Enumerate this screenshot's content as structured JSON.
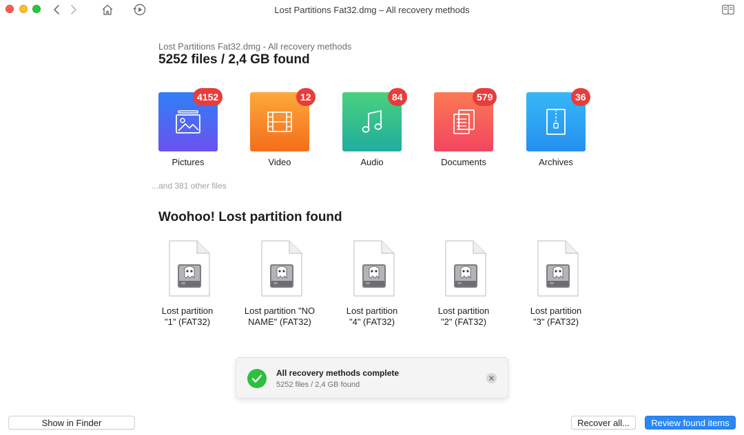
{
  "window": {
    "title": "Lost Partitions Fat32.dmg – All recovery methods"
  },
  "toolbar": {
    "icons": [
      "chevron-left-icon",
      "chevron-right-icon",
      "home-icon",
      "history-icon",
      "sidebar-icon"
    ]
  },
  "header": {
    "subtitle": "Lost Partitions Fat32.dmg - All recovery methods",
    "summary": "5252 files / 2,4 GB found"
  },
  "categories": [
    {
      "label": "Pictures",
      "count": "4152",
      "icon": "picture-icon",
      "colors": [
        "#2f7ff5",
        "#6b52f0"
      ]
    },
    {
      "label": "Video",
      "count": "12",
      "icon": "film-icon",
      "colors": [
        "#fba93a",
        "#f56d1b"
      ]
    },
    {
      "label": "Audio",
      "count": "84",
      "icon": "music-note-icon",
      "colors": [
        "#4ad07f",
        "#1fae9d"
      ]
    },
    {
      "label": "Documents",
      "count": "579",
      "icon": "document-icon",
      "colors": [
        "#fb7a54",
        "#f24561"
      ]
    },
    {
      "label": "Archives",
      "count": "36",
      "icon": "archive-icon",
      "colors": [
        "#36b7f6",
        "#2590f0"
      ]
    }
  ],
  "other_files": "...and 381 other files",
  "partitions": {
    "heading": "Woohoo! Lost partition found",
    "items": [
      {
        "line1": "Lost partition",
        "line2": "\"1\" (FAT32)"
      },
      {
        "line1": "Lost partition \"NO",
        "line2": "NAME\" (FAT32)"
      },
      {
        "line1": "Lost partition",
        "line2": "\"4\" (FAT32)"
      },
      {
        "line1": "Lost partition",
        "line2": "\"2\" (FAT32)"
      },
      {
        "line1": "Lost partition",
        "line2": "\"3\" (FAT32)"
      }
    ]
  },
  "notification": {
    "title": "All recovery methods complete",
    "subtitle": "5252 files / 2,4 GB found"
  },
  "footer": {
    "show_in_finder": "Show in Finder",
    "recover_all": "Recover all...",
    "review": "Review found items"
  }
}
